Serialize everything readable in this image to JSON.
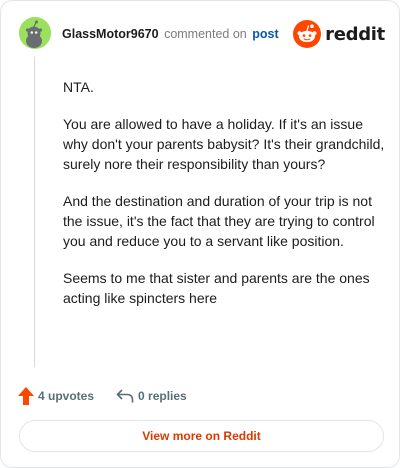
{
  "header": {
    "username": "GlassMotor9670",
    "action": "commented on",
    "post_link": "post",
    "brand": "reddit"
  },
  "comment": {
    "paragraphs": [
      "NTA.",
      "You are allowed to have a holiday. If it's an issue why don't your parents babysit? It's their grandchild, surely nore their responsibility than yours?",
      "And the destination and duration of your trip is not the issue, it's the fact that they are trying to control you and reduce you to a servant like position.",
      "Seems to me that sister and parents are the ones acting like spincters here"
    ]
  },
  "footer": {
    "upvotes": "4 upvotes",
    "replies": "0 replies"
  },
  "view_more_label": "View more on Reddit",
  "colors": {
    "brand_orange": "#ff4500",
    "link_blue": "#0a58a8",
    "cta_orange": "#d93a00",
    "avatar_green": "#9be15d"
  },
  "icons": [
    "snoo-avatar-icon",
    "reddit-logo-icon",
    "upvote-arrow-icon",
    "reply-arrow-icon"
  ]
}
